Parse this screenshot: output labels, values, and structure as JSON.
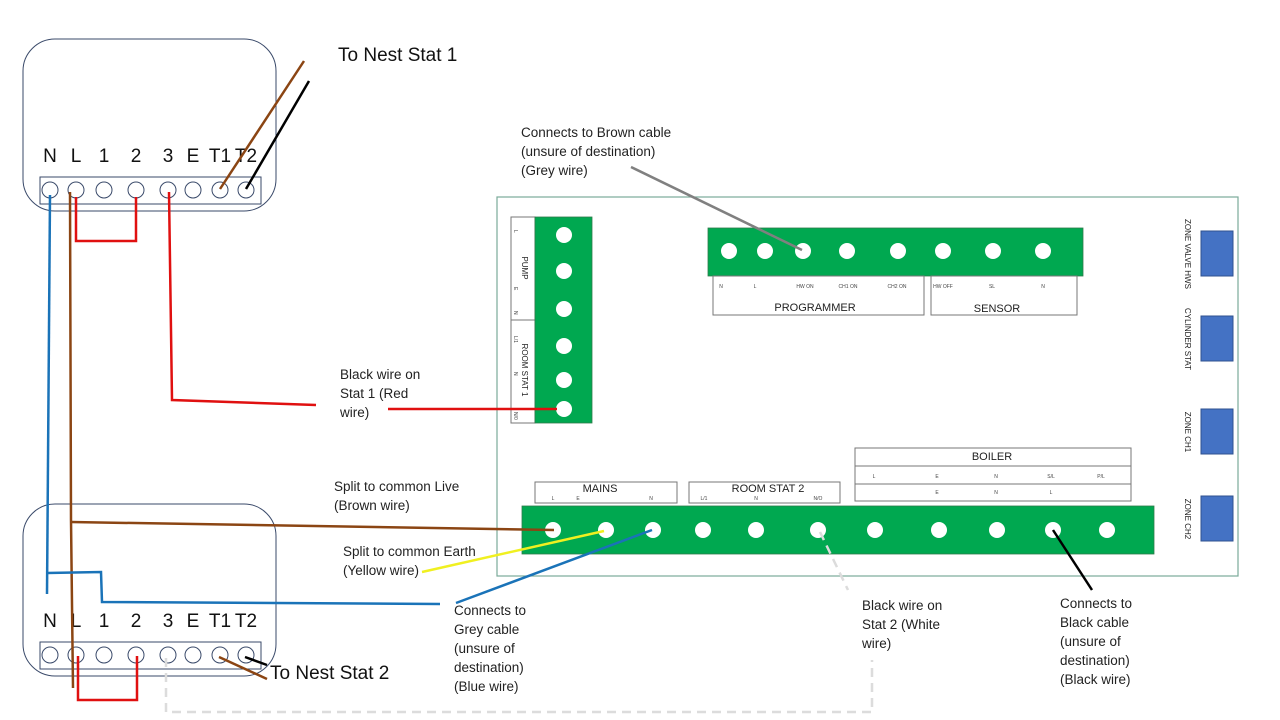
{
  "diagram": {
    "title_stat1": "To Nest Stat 1",
    "title_stat2": "To Nest Stat 2",
    "wiring_centre_terminals": [
      "N",
      "L",
      "1",
      "2",
      "3",
      "E",
      "T1",
      "T2"
    ],
    "annotations": {
      "grey_wire": "Connects to Brown cable\n(unsure of destination)\n(Grey wire)",
      "red_wire": "Black wire on\nStat 1 (Red\nwire)",
      "brown_wire": "Split to common Live\n(Brown wire)",
      "yellow_wire": "Split to common Earth\n(Yellow wire)",
      "blue_wire": "Connects to\nGrey cable\n(unsure of\ndestination)\n(Blue wire)",
      "white_wire": "Black wire on\nStat 2 (White\nwire)",
      "black_wire": "Connects to\nBlack cable\n(unsure of\ndestination)\n(Black wire)"
    },
    "board": {
      "programmer": {
        "label": "PROGRAMMER",
        "terminals": [
          "N",
          "L",
          "HW ON",
          "CH1 ON",
          "CH2 ON"
        ]
      },
      "sensor": {
        "label": "SENSOR",
        "terminals": [
          "HW OFF",
          "SL",
          "N"
        ]
      },
      "pump": {
        "label": "PUMP",
        "terminals": [
          "L",
          "E",
          "N"
        ]
      },
      "room_stat_1": {
        "label": "ROOM STAT 1",
        "terminals": [
          "L/1",
          "N",
          "N/0"
        ]
      },
      "mains": {
        "label": "MAINS",
        "terminals": [
          "L",
          "E",
          "N"
        ]
      },
      "room_stat_2": {
        "label": "ROOM STAT  2",
        "terminals": [
          "L/1",
          "N",
          "N/O"
        ]
      },
      "boiler": {
        "label": "BOILER",
        "row1": [
          "L",
          "E",
          "N",
          "S/L",
          "P/L"
        ],
        "row2": [
          "",
          "E",
          "N",
          "L",
          ""
        ]
      },
      "side_connectors": [
        "ZONE VALVE HWS",
        "CYLINDER STAT",
        "ZONE CH1",
        "ZONE CH2"
      ]
    },
    "colors": {
      "board_green": "#00a850",
      "connector_blue": "#4472c4",
      "wire_red": "#e01010",
      "wire_brown": "#8b4513",
      "wire_blue": "#1a73b8",
      "wire_yellow": "#f0f020",
      "wire_grey": "#808080",
      "wire_black": "#000000",
      "wire_white": "#d8d8d8"
    }
  }
}
